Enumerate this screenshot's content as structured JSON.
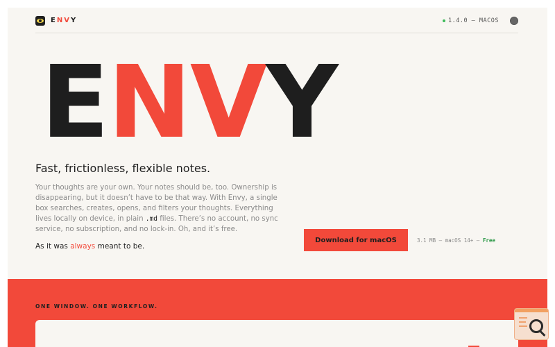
{
  "header": {
    "brand": "ENVY",
    "brand_letters": [
      "E",
      "N",
      "V",
      "Y"
    ],
    "version": "1.4.0 — MACOS"
  },
  "hero": {
    "letters": [
      "E",
      "N",
      "V",
      "Y"
    ],
    "tagline": "Fast, frictionless, flexible notes.",
    "desc_part1": "Your thoughts are your own. Your notes should be, too. Ownership is disappearing, but it doesn’t have to be that way. With Envy, a single box searches, creates, opens, and filters your thoughts. Everything lives locally on device, in plain ",
    "desc_code": ".md",
    "desc_part2": " files. There’s no account, no sync service, no subscription, and no lock-in. Oh, and it’s free.",
    "closing_pre": "As it was ",
    "closing_highlight": "always",
    "closing_post": " meant to be."
  },
  "download": {
    "label": "Download for macOS",
    "meta": "3.1 MB — macOS 14+ — ",
    "price": "Free"
  },
  "section": {
    "label": "ONE WINDOW. ONE WORKFLOW."
  },
  "colors": {
    "accent": "#f2493a",
    "dark": "#1e1e1e",
    "background": "#f8f6f2",
    "status_green": "#3dbb5a"
  },
  "icons": {
    "logo": "eye-logo-icon",
    "status": "status-dot-icon",
    "theme": "theme-toggle-icon",
    "badge": "magnifier-badge-icon"
  }
}
